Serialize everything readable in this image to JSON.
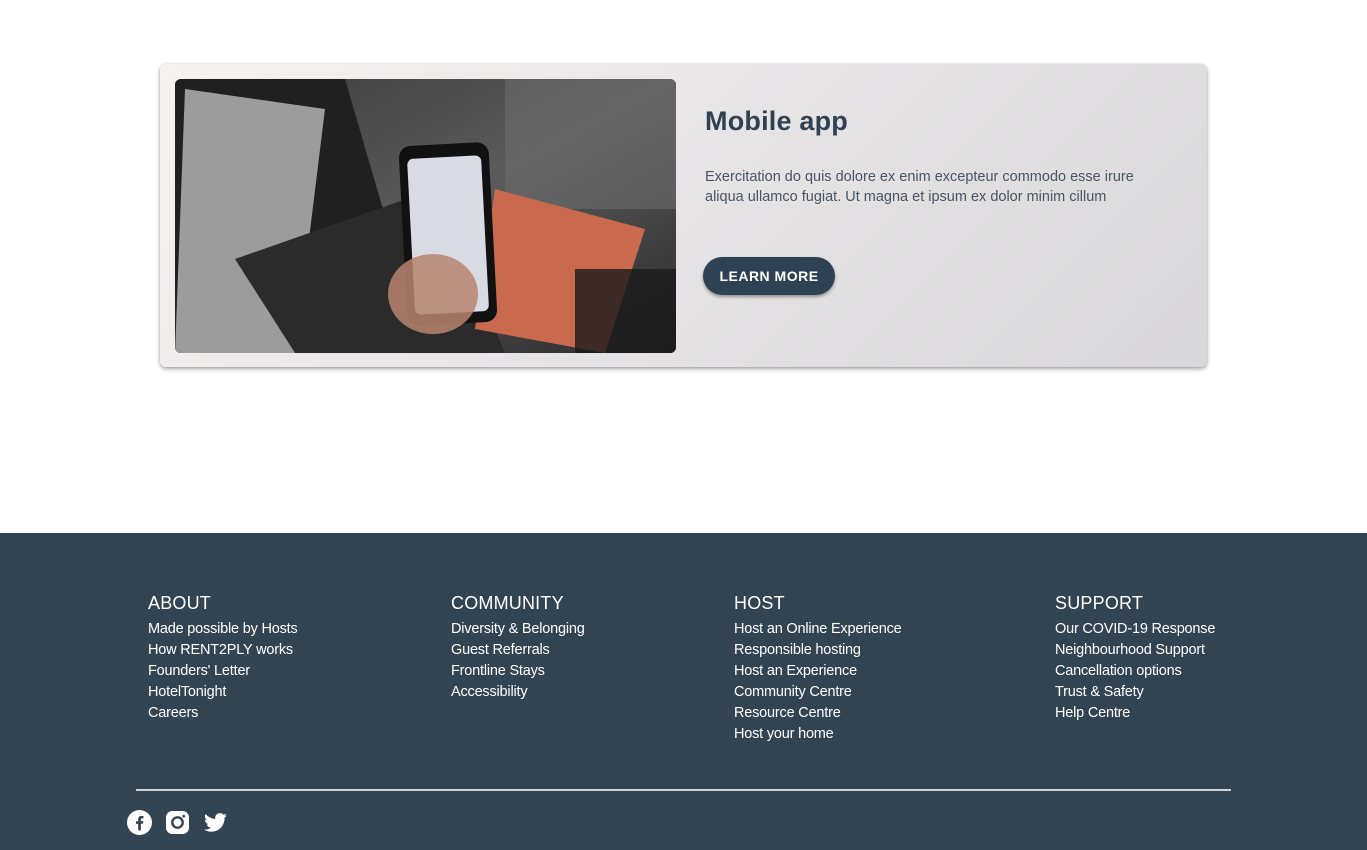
{
  "card": {
    "title": "Mobile app",
    "text": "Exercitation do quis dolore ex enim excepteur commodo esse irure aliqua ullamco fugiat. Ut magna et ipsum ex dolor minim cillum",
    "button_label": "LEARN MORE",
    "image_description": "photo-phone-in-hand-laptop"
  },
  "footer": {
    "columns": [
      {
        "title": "ABOUT",
        "links": [
          "Made possible by Hosts",
          "How RENT2PLY works",
          "Founders' Letter",
          "HotelTonight",
          "Careers"
        ]
      },
      {
        "title": "COMMUNITY",
        "links": [
          "Diversity & Belonging",
          "Guest Referrals",
          "Frontline Stays",
          "Accessibility"
        ]
      },
      {
        "title": "HOST",
        "links": [
          "Host an Online Experience",
          "Responsible hosting",
          "Host an Experience",
          "Community Centre",
          "Resource Centre",
          "Host your home"
        ]
      },
      {
        "title": "SUPPORT",
        "links": [
          "Our COVID-19 Response",
          "Neighbourhood Support",
          "Cancellation options",
          "Trust & Safety",
          "Help Centre"
        ]
      }
    ],
    "social_icons": [
      "facebook-icon",
      "instagram-icon",
      "twitter-icon"
    ]
  },
  "colors": {
    "primary": "#2f4254",
    "footer_bg": "#324352",
    "text_muted": "#4a5563"
  }
}
